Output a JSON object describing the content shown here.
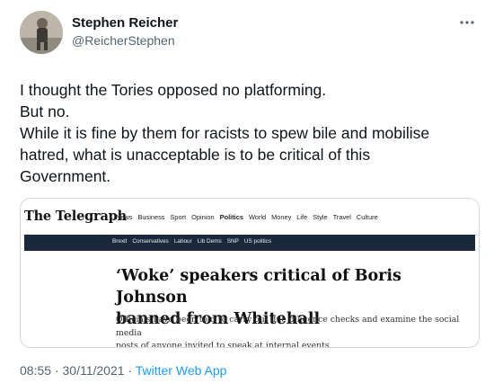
{
  "author": {
    "name": "Stephen Reicher",
    "handle": "@ReicherStephen"
  },
  "tweet": {
    "lines": [
      "I thought the Tories opposed no platforming.",
      "But no.",
      "While it is fine by them for racists to spew bile and mobilise",
      "hatred, what is unacceptable is to be critical of this",
      "Government."
    ]
  },
  "card": {
    "logo": "The Telegraph",
    "nav": [
      "News",
      "Business",
      "Sport",
      "Opinion",
      "Politics",
      "World",
      "Money",
      "Life",
      "Style",
      "Travel",
      "Culture"
    ],
    "subnav": [
      "Brexit",
      "Conservatives",
      "Labour",
      "Lib Dems",
      "SNP",
      "US politics"
    ],
    "headline_line1": "‘Woke’ speakers critical of Boris Johnson",
    "headline_line2": "banned from Whitehall",
    "standfirst_line1": "Officials have been told to carry out due diligence checks and examine the social media",
    "standfirst_line2": "posts of anyone invited to speak at internal events"
  },
  "meta": {
    "time": "08:55",
    "separator": "·",
    "date": "30/11/2021",
    "app": "Twitter Web App"
  },
  "colors": {
    "link": "#1d9bf0",
    "secondary": "#536471",
    "telegraph_nav": "#19283a"
  }
}
